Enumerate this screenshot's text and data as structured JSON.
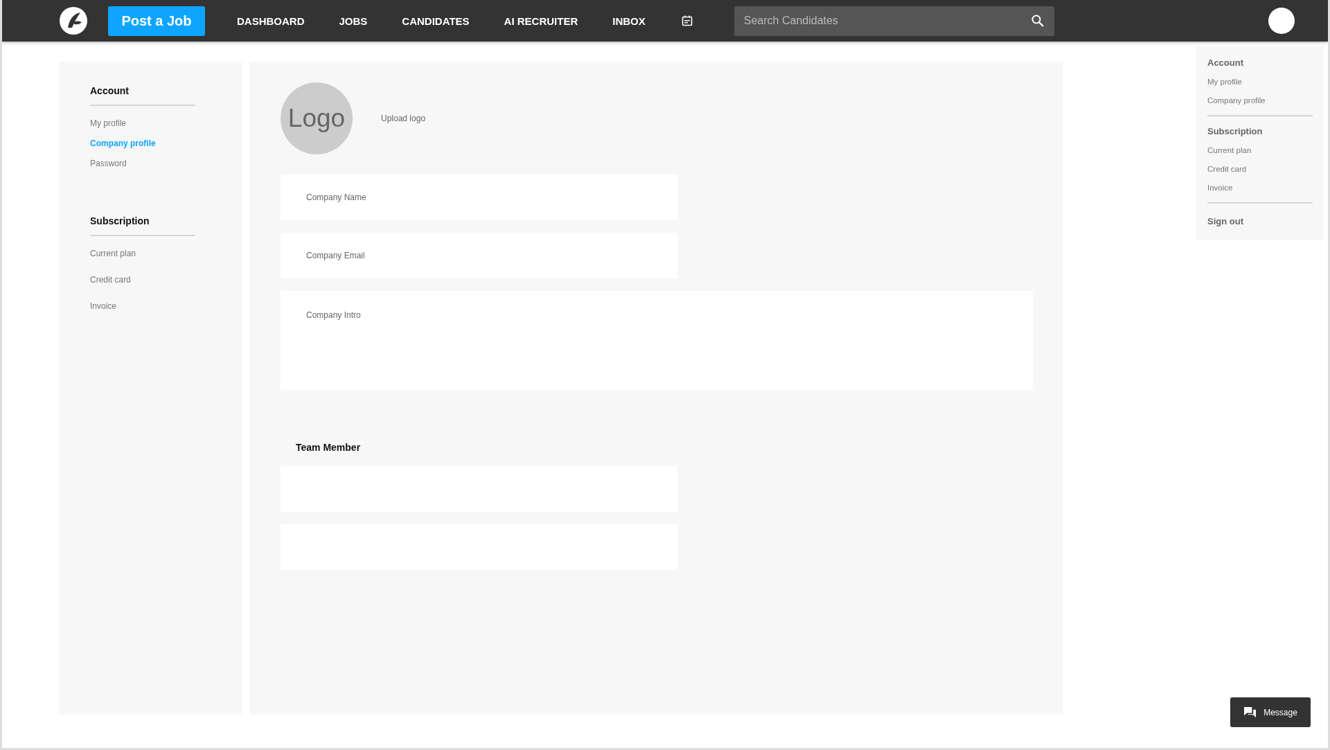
{
  "header": {
    "post_button": "Post a Job",
    "nav": [
      "DASHBOARD",
      "JOBS",
      "CANDIDATES",
      "AI RECRUITER",
      "INBOX"
    ],
    "search": {
      "placeholder": "Search Candidates"
    }
  },
  "sidebar": {
    "sections": [
      {
        "title": "Account",
        "items": [
          {
            "label": "My profile",
            "selected": false
          },
          {
            "label": "Company profile",
            "selected": true
          },
          {
            "label": "Password",
            "selected": false
          }
        ]
      },
      {
        "title": "Subscription",
        "items": [
          {
            "label": "Current plan",
            "selected": false
          },
          {
            "label": "Credit card",
            "selected": false
          },
          {
            "label": "Invoice",
            "selected": false
          }
        ]
      }
    ]
  },
  "profile": {
    "logo_text": "Logo",
    "upload_link": "Upload logo",
    "fields": [
      {
        "placeholder": "Company Name",
        "kind": "line"
      },
      {
        "placeholder": "Company Email",
        "kind": "line"
      },
      {
        "placeholder": "Company Intro",
        "kind": "area"
      }
    ],
    "team_title": "Team Member"
  },
  "account_menu": {
    "sections": [
      {
        "title": "Account",
        "items": [
          "My profile",
          "Company profile"
        ]
      },
      {
        "title": "Subscription",
        "items": [
          "Current plan",
          "Credit card",
          "Invoice"
        ]
      }
    ],
    "sign_out": "Sign out"
  },
  "message_button": "Message"
}
